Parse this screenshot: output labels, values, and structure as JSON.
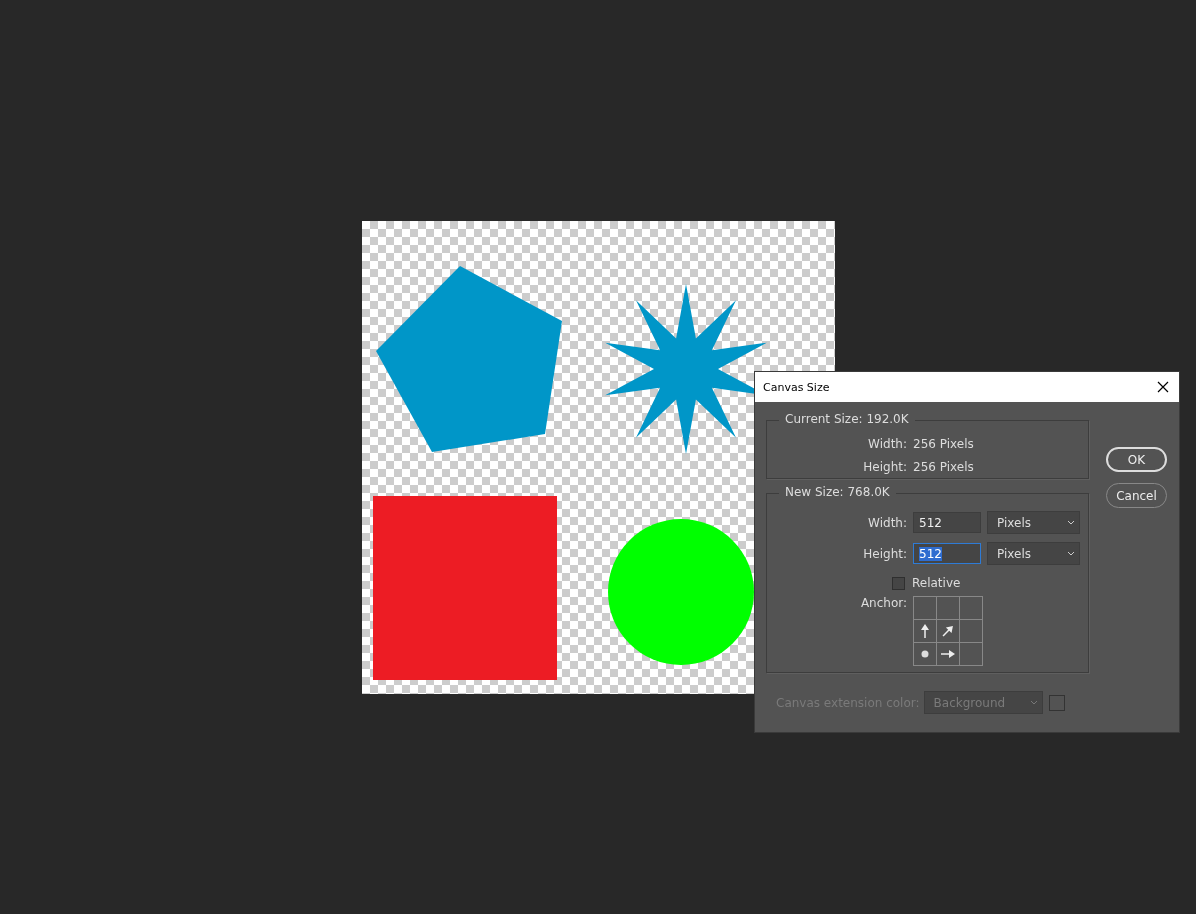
{
  "canvas": {
    "shapes": [
      {
        "kind": "pentagon",
        "color": "#0096c8"
      },
      {
        "kind": "star",
        "color": "#0096c8"
      },
      {
        "kind": "square",
        "color": "#ed1c24"
      },
      {
        "kind": "circle",
        "color": "#00ff00"
      }
    ]
  },
  "dialog": {
    "title": "Canvas Size",
    "current_size": {
      "legend": "Current Size: 192.0K",
      "rows": [
        {
          "label": "Width:",
          "value": "256 Pixels"
        },
        {
          "label": "Height:",
          "value": "256 Pixels"
        }
      ]
    },
    "new_size": {
      "legend": "New Size: 768.0K",
      "fields": [
        {
          "label": "Width:",
          "value": "512",
          "unit": "Pixels",
          "focused": false
        },
        {
          "label": "Height:",
          "value": "512",
          "unit": "Pixels",
          "focused": true
        }
      ],
      "relative": {
        "label": "Relative",
        "checked": false
      },
      "anchor": {
        "label": "Anchor:",
        "cells": [
          {
            "selected": false
          },
          {
            "selected": false
          },
          {
            "selected": false
          },
          {
            "selected": false
          },
          {
            "selected": false
          },
          {
            "selected": false
          },
          {
            "selected": true
          },
          {
            "selected": false
          },
          {
            "selected": false
          }
        ]
      }
    },
    "extension_color": {
      "label": "Canvas extension color:",
      "value": "Background",
      "disabled": true
    },
    "buttons": [
      {
        "label": "OK",
        "default": true
      },
      {
        "label": "Cancel",
        "default": false
      }
    ]
  }
}
